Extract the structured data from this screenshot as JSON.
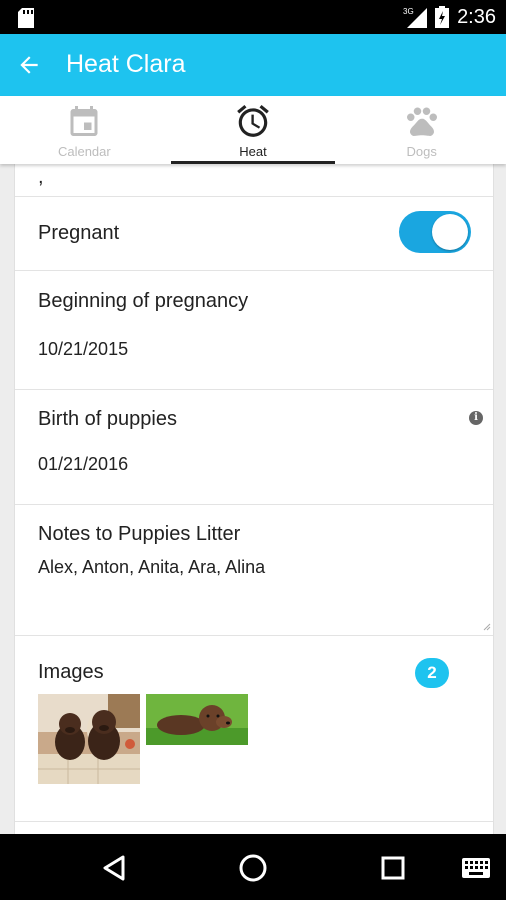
{
  "status_bar": {
    "time": "2:36",
    "network": "3G"
  },
  "app_bar": {
    "title": "Heat Clara"
  },
  "tabs": [
    {
      "label": "Calendar",
      "icon": "calendar-icon",
      "active": false
    },
    {
      "label": "Heat",
      "icon": "alarm-clock-icon",
      "active": true
    },
    {
      "label": "Dogs",
      "icon": "paw-icon",
      "active": false
    }
  ],
  "form": {
    "pregnant": {
      "label": "Pregnant",
      "checked": true
    },
    "pregnancy_start": {
      "label": "Beginning of pregnancy",
      "value": "10/21/2015"
    },
    "birth": {
      "label": "Birth of puppies",
      "value": "01/21/2016",
      "info_icon": "info-icon"
    },
    "notes": {
      "label": "Notes to Puppies Litter",
      "value": "Alex, Anton, Anita, Ara, Alina"
    },
    "images": {
      "label": "Images",
      "count": "2"
    }
  },
  "colors": {
    "accent": "#1ec3ef",
    "toggle": "#1aa6e0"
  }
}
